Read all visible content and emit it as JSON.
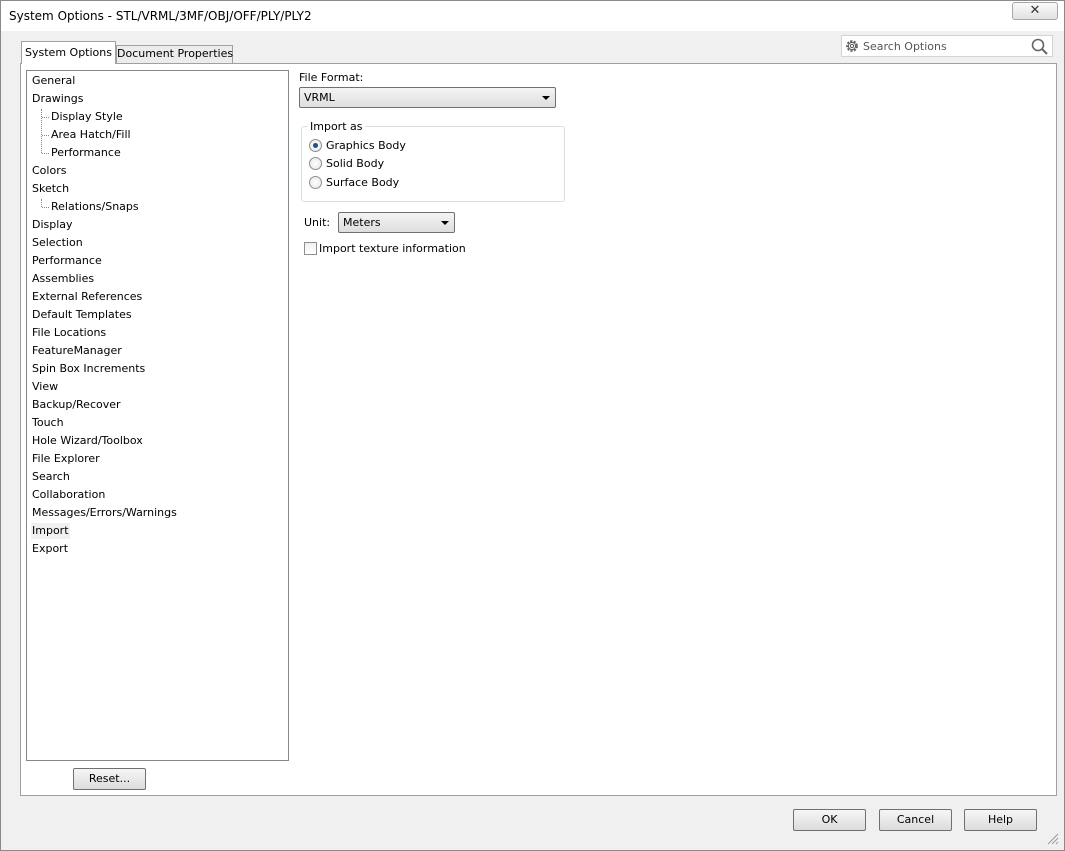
{
  "window": {
    "title": "System Options - STL/VRML/3MF/OBJ/OFF/PLY/PLY2",
    "close_label": "✕"
  },
  "search": {
    "placeholder": "Search Options",
    "icon": "search-icon",
    "gear_icon": "gear-icon"
  },
  "tabs": {
    "system_options": "System Options",
    "document_properties": "Document Properties",
    "active": "System Options"
  },
  "tree": {
    "selected": "Import",
    "items": [
      {
        "label": "General",
        "level": 0
      },
      {
        "label": "Drawings",
        "level": 0
      },
      {
        "label": "Display Style",
        "level": 1
      },
      {
        "label": "Area Hatch/Fill",
        "level": 1
      },
      {
        "label": "Performance",
        "level": 1
      },
      {
        "label": "Colors",
        "level": 0
      },
      {
        "label": "Sketch",
        "level": 0
      },
      {
        "label": "Relations/Snaps",
        "level": 1
      },
      {
        "label": "Display",
        "level": 0
      },
      {
        "label": "Selection",
        "level": 0
      },
      {
        "label": "Performance",
        "level": 0
      },
      {
        "label": "Assemblies",
        "level": 0
      },
      {
        "label": "External References",
        "level": 0
      },
      {
        "label": "Default Templates",
        "level": 0
      },
      {
        "label": "File Locations",
        "level": 0
      },
      {
        "label": "FeatureManager",
        "level": 0
      },
      {
        "label": "Spin Box Increments",
        "level": 0
      },
      {
        "label": "View",
        "level": 0
      },
      {
        "label": "Backup/Recover",
        "level": 0
      },
      {
        "label": "Touch",
        "level": 0
      },
      {
        "label": "Hole Wizard/Toolbox",
        "level": 0
      },
      {
        "label": "File Explorer",
        "level": 0
      },
      {
        "label": "Search",
        "level": 0
      },
      {
        "label": "Collaboration",
        "level": 0
      },
      {
        "label": "Messages/Errors/Warnings",
        "level": 0
      },
      {
        "label": "Import",
        "level": 0
      },
      {
        "label": "Export",
        "level": 0
      }
    ]
  },
  "content": {
    "file_format_label": "File Format:",
    "file_format_value": "VRML",
    "import_as": {
      "legend": "Import as",
      "selected": "Graphics Body",
      "options": [
        "Graphics Body",
        "Solid Body",
        "Surface Body"
      ]
    },
    "unit_label": "Unit:",
    "unit_value": "Meters",
    "texture_label": "Import texture information",
    "texture_checked": false
  },
  "buttons": {
    "reset": "Reset...",
    "ok": "OK",
    "cancel": "Cancel",
    "help": "Help"
  }
}
